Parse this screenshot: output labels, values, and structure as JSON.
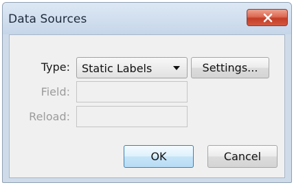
{
  "window": {
    "title": "Data Sources"
  },
  "form": {
    "type_label": "Type:",
    "type_value": "Static Labels",
    "settings_button": "Settings...",
    "field_label": "Field:",
    "field_value": "",
    "reload_label": "Reload:",
    "reload_value": ""
  },
  "buttons": {
    "ok": "OK",
    "cancel": "Cancel"
  },
  "icons": {
    "close": "close-icon",
    "dropdown": "chevron-down-icon"
  },
  "colors": {
    "close_button": "#d2583f",
    "default_button_border": "#3c7fb1"
  }
}
